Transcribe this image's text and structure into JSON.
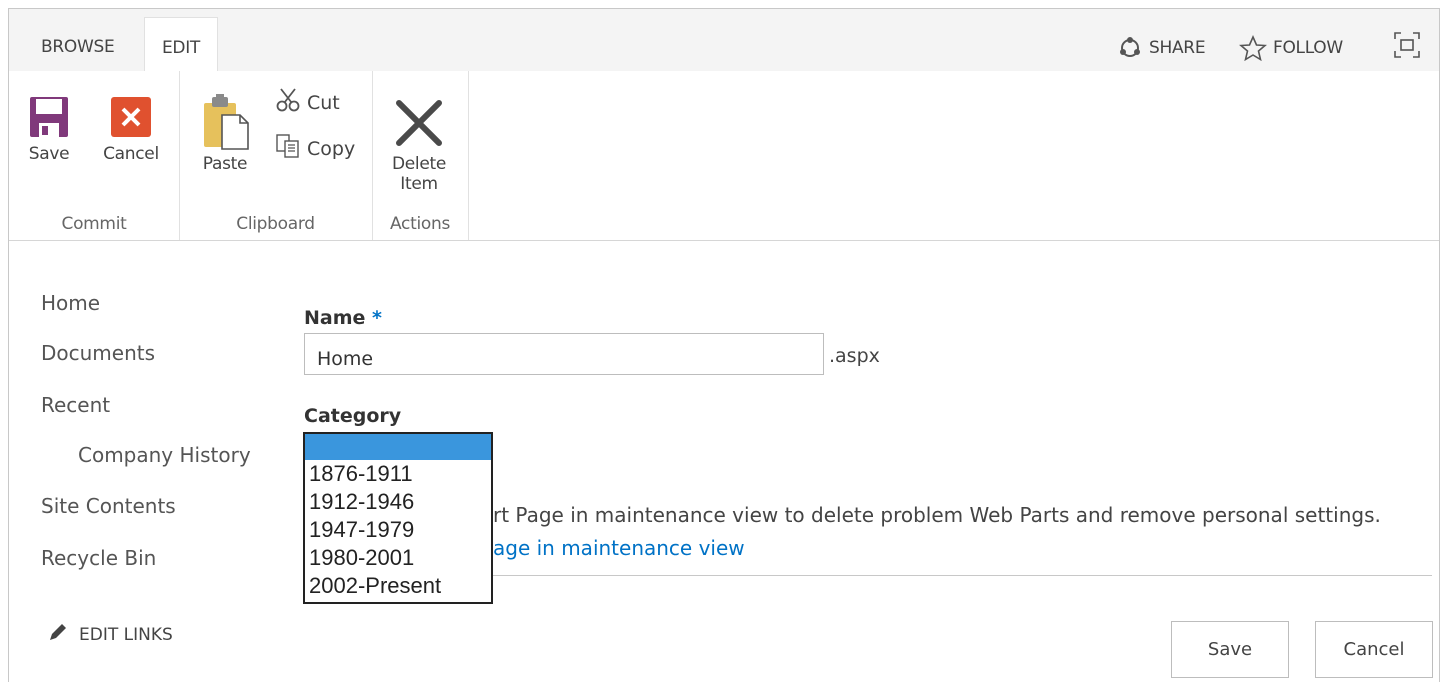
{
  "tabs": [
    {
      "label": "BROWSE"
    },
    {
      "label": "EDIT"
    }
  ],
  "top_actions": {
    "share": "SHARE",
    "follow": "FOLLOW"
  },
  "ribbon": {
    "commit": {
      "save": "Save",
      "cancel": "Cancel",
      "group": "Commit"
    },
    "clipboard": {
      "paste": "Paste",
      "cut": "Cut",
      "copy": "Copy",
      "group": "Clipboard"
    },
    "actions": {
      "delete_line1": "Delete",
      "delete_line2": "Item",
      "group": "Actions"
    }
  },
  "nav": {
    "items": [
      "Home",
      "Documents",
      "Recent",
      "Company History",
      "Site Contents",
      "Recycle Bin"
    ],
    "edit_links": "EDIT LINKS"
  },
  "form": {
    "name_label": "Name",
    "required_mark": "*",
    "name_value": "Home",
    "name_suffix": ".aspx",
    "category_label": "Category",
    "category_options": [
      "",
      "1876-1911",
      "1912-1946",
      "1947-1979",
      "1980-2001",
      "2002-Present"
    ],
    "category_selected_index": 0,
    "maintenance_text": "rt Page in maintenance view to delete problem Web Parts and remove personal settings.",
    "maintenance_link": "age in maintenance view",
    "save": "Save",
    "cancel": "Cancel"
  },
  "colors": {
    "accent": "#0072c6",
    "selected_option": "#3a96dd",
    "save_icon": "#80397b",
    "cancel_icon": "#e0512f"
  }
}
